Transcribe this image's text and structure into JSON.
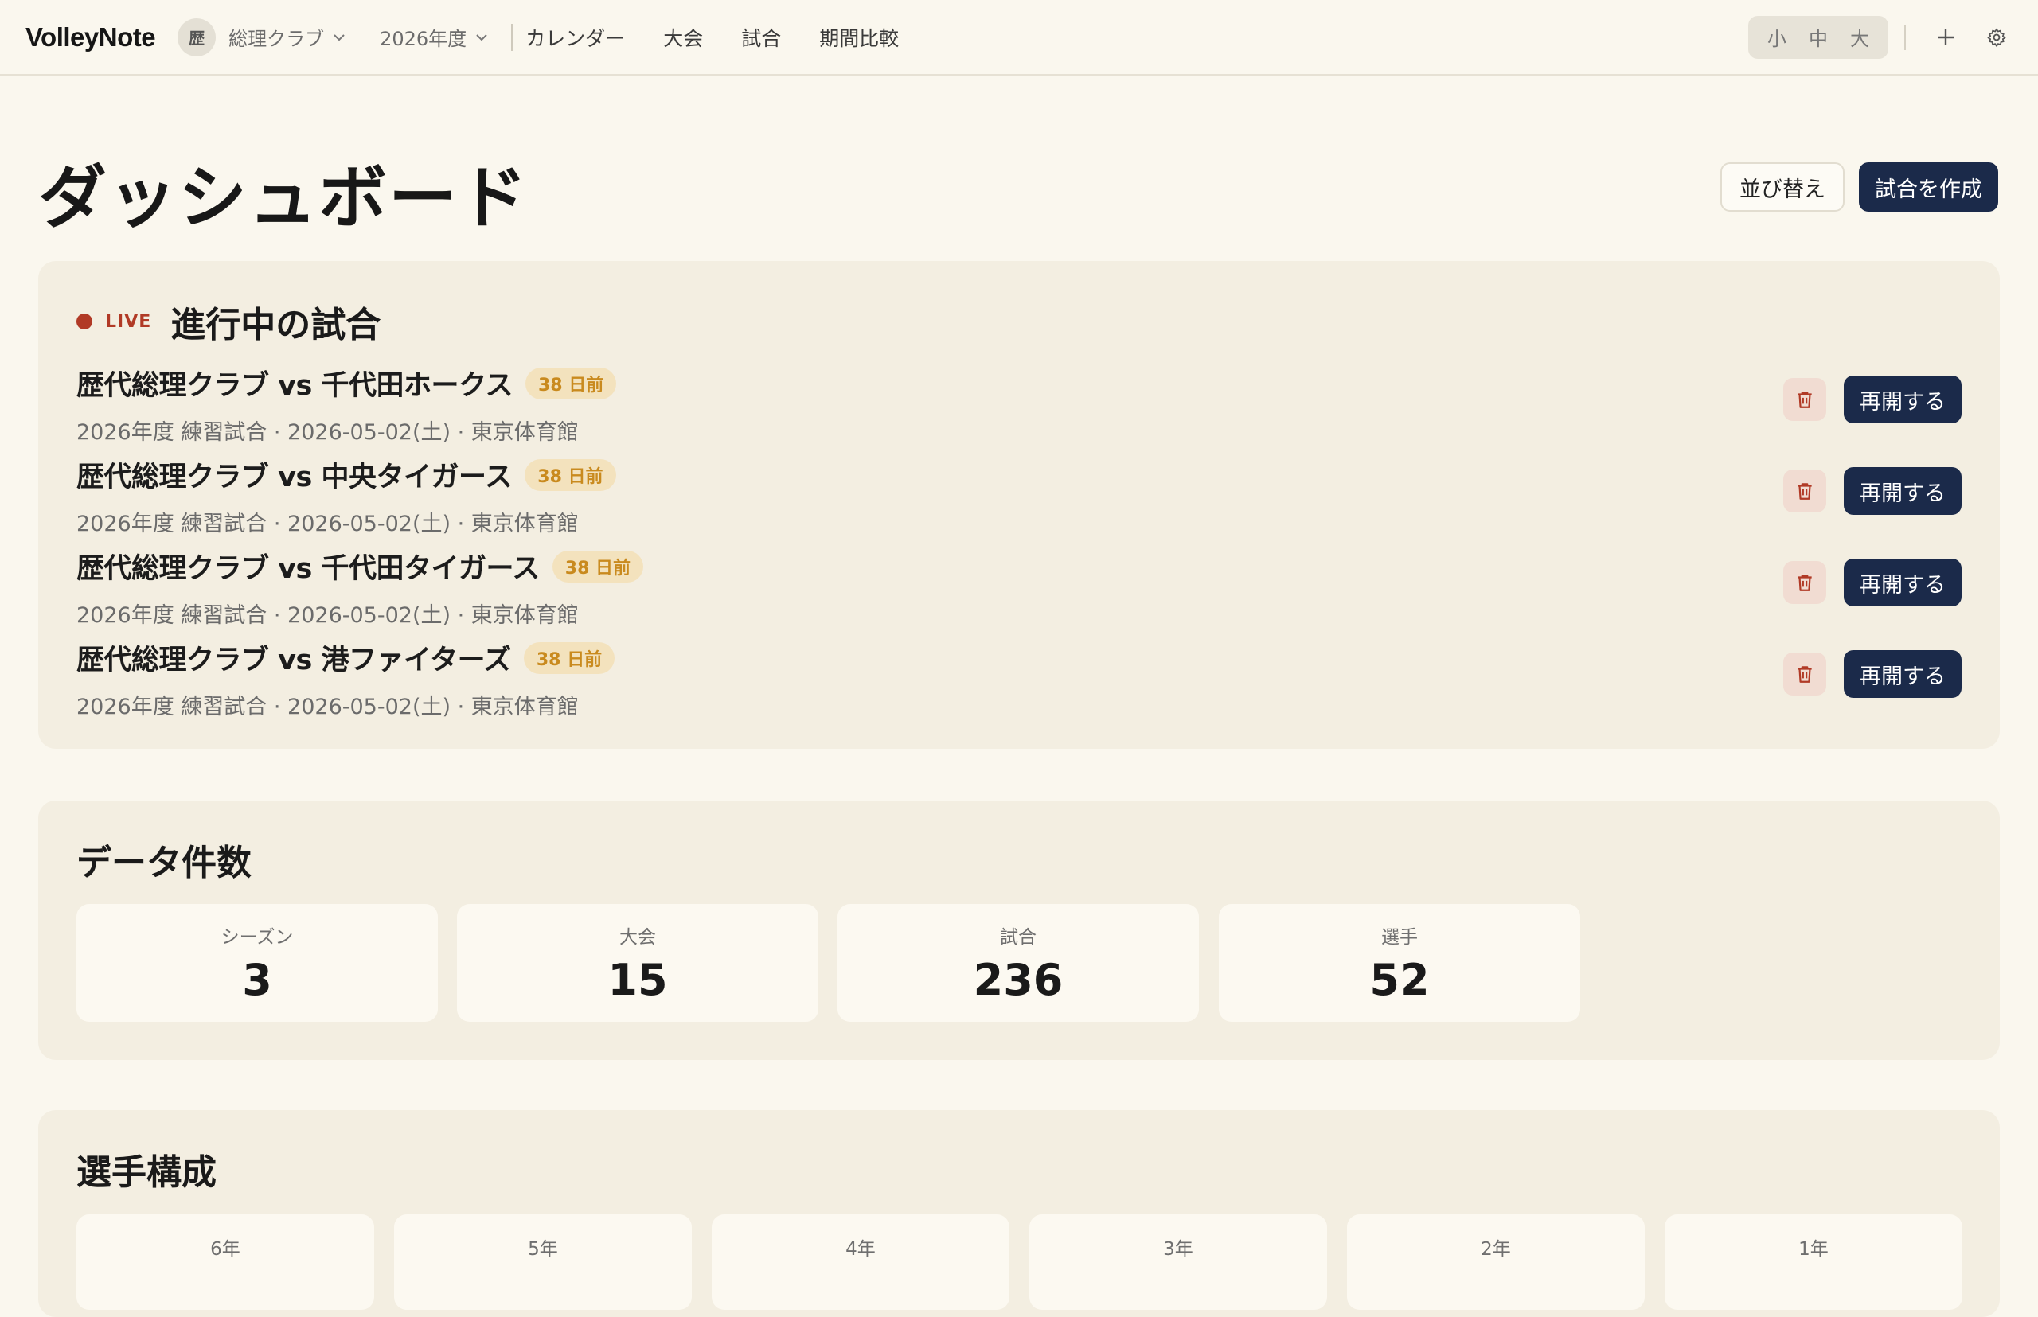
{
  "nav": {
    "brand": "VolleyNote",
    "club_avatar": "歴",
    "club_name": "総理クラブ",
    "season": "2026年度",
    "links": [
      "カレンダー",
      "大会",
      "試合",
      "期間比較"
    ],
    "size_options": [
      "小",
      "中",
      "大"
    ]
  },
  "page": {
    "title": "ダッシュボード",
    "sort_label": "並び替え",
    "create_label": "試合を作成"
  },
  "live": {
    "live_label": "LIVE",
    "title": "進行中の試合",
    "resume_label": "再開する",
    "matches": [
      {
        "title": "歴代総理クラブ vs 千代田ホークス",
        "badge": "38 日前",
        "meta": "2026年度 練習試合 · 2026-05-02(土) · 東京体育館"
      },
      {
        "title": "歴代総理クラブ vs 中央タイガース",
        "badge": "38 日前",
        "meta": "2026年度 練習試合 · 2026-05-02(土) · 東京体育館"
      },
      {
        "title": "歴代総理クラブ vs 千代田タイガース",
        "badge": "38 日前",
        "meta": "2026年度 練習試合 · 2026-05-02(土) · 東京体育館"
      },
      {
        "title": "歴代総理クラブ vs 港ファイターズ",
        "badge": "38 日前",
        "meta": "2026年度 練習試合 · 2026-05-02(土) · 東京体育館"
      }
    ]
  },
  "counts": {
    "title": "データ件数",
    "items": [
      {
        "label": "シーズン",
        "value": "3"
      },
      {
        "label": "大会",
        "value": "15"
      },
      {
        "label": "試合",
        "value": "236"
      },
      {
        "label": "選手",
        "value": "52"
      }
    ]
  },
  "roster": {
    "title": "選手構成",
    "grades": [
      {
        "label": "6年"
      },
      {
        "label": "5年"
      },
      {
        "label": "4年"
      },
      {
        "label": "3年"
      },
      {
        "label": "2年"
      },
      {
        "label": "1年"
      }
    ]
  },
  "colors": {
    "background": "#faf7ee",
    "panel": "#f3eee1",
    "primary": "#1b2a4a",
    "live_red": "#b13a26",
    "badge_bg": "#f3e2bd",
    "badge_text": "#c98a1e"
  }
}
